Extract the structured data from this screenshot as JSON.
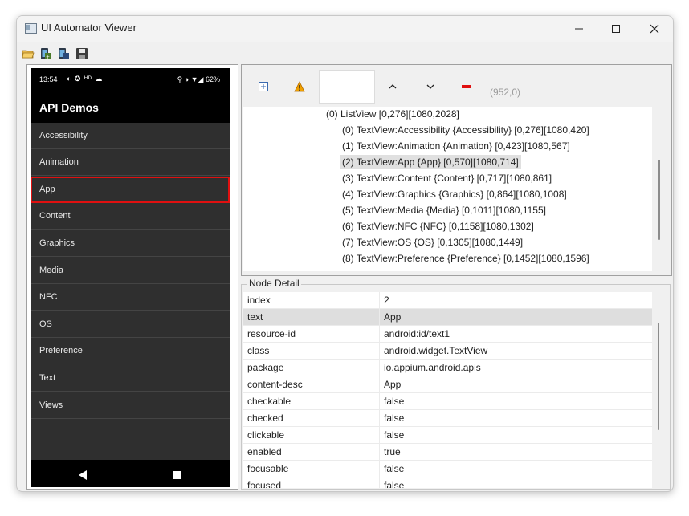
{
  "window": {
    "title": "UI Automator Viewer"
  },
  "phone": {
    "status_time": "13:54",
    "status_battery": "62%",
    "app_title": "API Demos",
    "items": [
      {
        "label": "Accessibility"
      },
      {
        "label": "Animation"
      },
      {
        "label": "App"
      },
      {
        "label": "Content"
      },
      {
        "label": "Graphics"
      },
      {
        "label": "Media"
      },
      {
        "label": "NFC"
      },
      {
        "label": "OS"
      },
      {
        "label": "Preference"
      },
      {
        "label": "Text"
      },
      {
        "label": "Views"
      }
    ],
    "selected_index": 2
  },
  "hierarchy": {
    "coord": "(952,0)",
    "rows": [
      {
        "text": "(0) ListView [0,276][1080,2028]",
        "level": 0
      },
      {
        "text": "(0) TextView:Accessibility {Accessibility} [0,276][1080,420]",
        "level": 1
      },
      {
        "text": "(1) TextView:Animation {Animation} [0,423][1080,567]",
        "level": 1
      },
      {
        "text": "(2) TextView:App {App} [0,570][1080,714]",
        "level": 1,
        "selected": true
      },
      {
        "text": "(3) TextView:Content {Content} [0,717][1080,861]",
        "level": 1
      },
      {
        "text": "(4) TextView:Graphics {Graphics} [0,864][1080,1008]",
        "level": 1
      },
      {
        "text": "(5) TextView:Media {Media} [0,1011][1080,1155]",
        "level": 1
      },
      {
        "text": "(6) TextView:NFC {NFC} [0,1158][1080,1302]",
        "level": 1
      },
      {
        "text": "(7) TextView:OS {OS} [0,1305][1080,1449]",
        "level": 1
      },
      {
        "text": "(8) TextView:Preference {Preference} [0,1452][1080,1596]",
        "level": 1
      }
    ]
  },
  "node_detail": {
    "title": "Node Detail",
    "rows": [
      {
        "key": "index",
        "value": "2"
      },
      {
        "key": "text",
        "value": "App",
        "selected": true
      },
      {
        "key": "resource-id",
        "value": "android:id/text1"
      },
      {
        "key": "class",
        "value": "android.widget.TextView"
      },
      {
        "key": "package",
        "value": "io.appium.android.apis"
      },
      {
        "key": "content-desc",
        "value": "App"
      },
      {
        "key": "checkable",
        "value": "false"
      },
      {
        "key": "checked",
        "value": "false"
      },
      {
        "key": "clickable",
        "value": "false"
      },
      {
        "key": "enabled",
        "value": "true"
      },
      {
        "key": "focusable",
        "value": "false"
      },
      {
        "key": "focused",
        "value": "false"
      }
    ]
  },
  "icons": {
    "toolbar": [
      "folder-open-icon",
      "device-screenshot-icon",
      "device-screenshot-compressed-icon",
      "save-icon"
    ],
    "hierarchy_toolbar": [
      "expand-all-icon",
      "warning-icon",
      "up-arrow-icon",
      "down-arrow-icon",
      "toggle-naf-icon"
    ]
  },
  "colors": {
    "selection_outline": "#e01010",
    "warning": "#f0a000"
  }
}
